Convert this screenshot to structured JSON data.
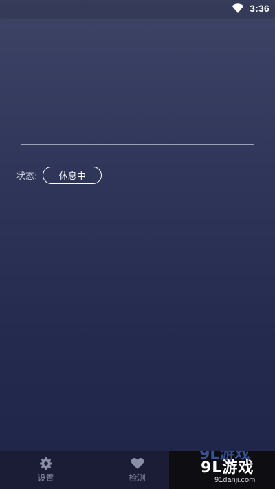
{
  "status_bar": {
    "time": "3:36",
    "wifi_icon": "wifi-icon"
  },
  "status_row": {
    "label": "状态:",
    "value": "休息中"
  },
  "bottom_nav": {
    "items": [
      {
        "label": "设置",
        "icon": "gear-icon"
      },
      {
        "label": "检测",
        "icon": "heart-icon"
      }
    ]
  },
  "watermark": {
    "logo_text": "9L游戏",
    "url": "91danji.com"
  },
  "colors": {
    "background_top": "#3d4466",
    "background_bottom": "#1f2548",
    "nav_background": "#1a1d35",
    "nav_text": "#8a8ea6"
  }
}
